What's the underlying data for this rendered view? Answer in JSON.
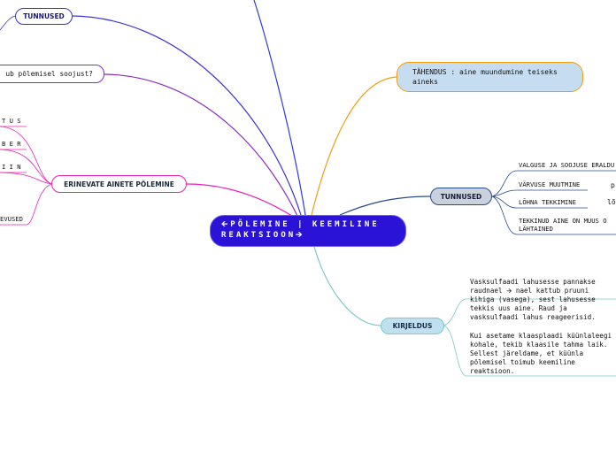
{
  "central": {
    "line1": "🡨PÕLEMINE | KEEMILINE",
    "line2": "REAKTSIOON🡪"
  },
  "left": {
    "tunnused_label": "TUNNUSED",
    "question_label": "ub põlemisel soojust?",
    "erinevate_label": "ERINEVATE AINETE PÕLEMINE",
    "fragments": [
      "T U S",
      "B E R",
      "I I N",
      "EVUSED"
    ]
  },
  "right": {
    "tahendus": "TÄHENDUS : aine muundumine teiseks aineks",
    "tunnused_label": "TUNNUSED",
    "tunnused_items": [
      "VALGUSE JA SOOJUSE ERALDU",
      "VÄRVUSE MUUTMINE",
      "LÕHNA TEKKIMINE",
      "TEKKINUD AINE ON MUUS O LÄHTAINED"
    ],
    "tunnused_extra": [
      "p",
      "lõ"
    ],
    "kirjeldus_label": "KIRJELDUS",
    "kirjeldus_notes": [
      "Vasksulfaadi lahusesse pannakse raudnael 🡪 nael kattub pruuni kihiga (vasega), sest lahusesse tekkis uus aine. Raud ja vasksulfaadi lahus reageerisid.",
      "Kui asetame klaasplaadi küünlaleegi kohale, tekib klaasile tahma laik. Sellest järeldame, et küünla põlemisel toimub keemiline reaktsioon."
    ]
  },
  "colors": {
    "central_fill": "#2a13d6",
    "left_tunnused_line": "#3b30d8",
    "question_line": "#8a2bc0",
    "erinevate_line": "#e81fb8",
    "tahendus_line": "#f39c12",
    "tahendus_fill": "#c6dcf0",
    "right_tunnused_line": "#274b8a",
    "right_tunnused_fill": "#c9d2dc",
    "kirjeldus_line": "#7ec8c8",
    "kirjeldus_fill": "#bfe0ef"
  }
}
